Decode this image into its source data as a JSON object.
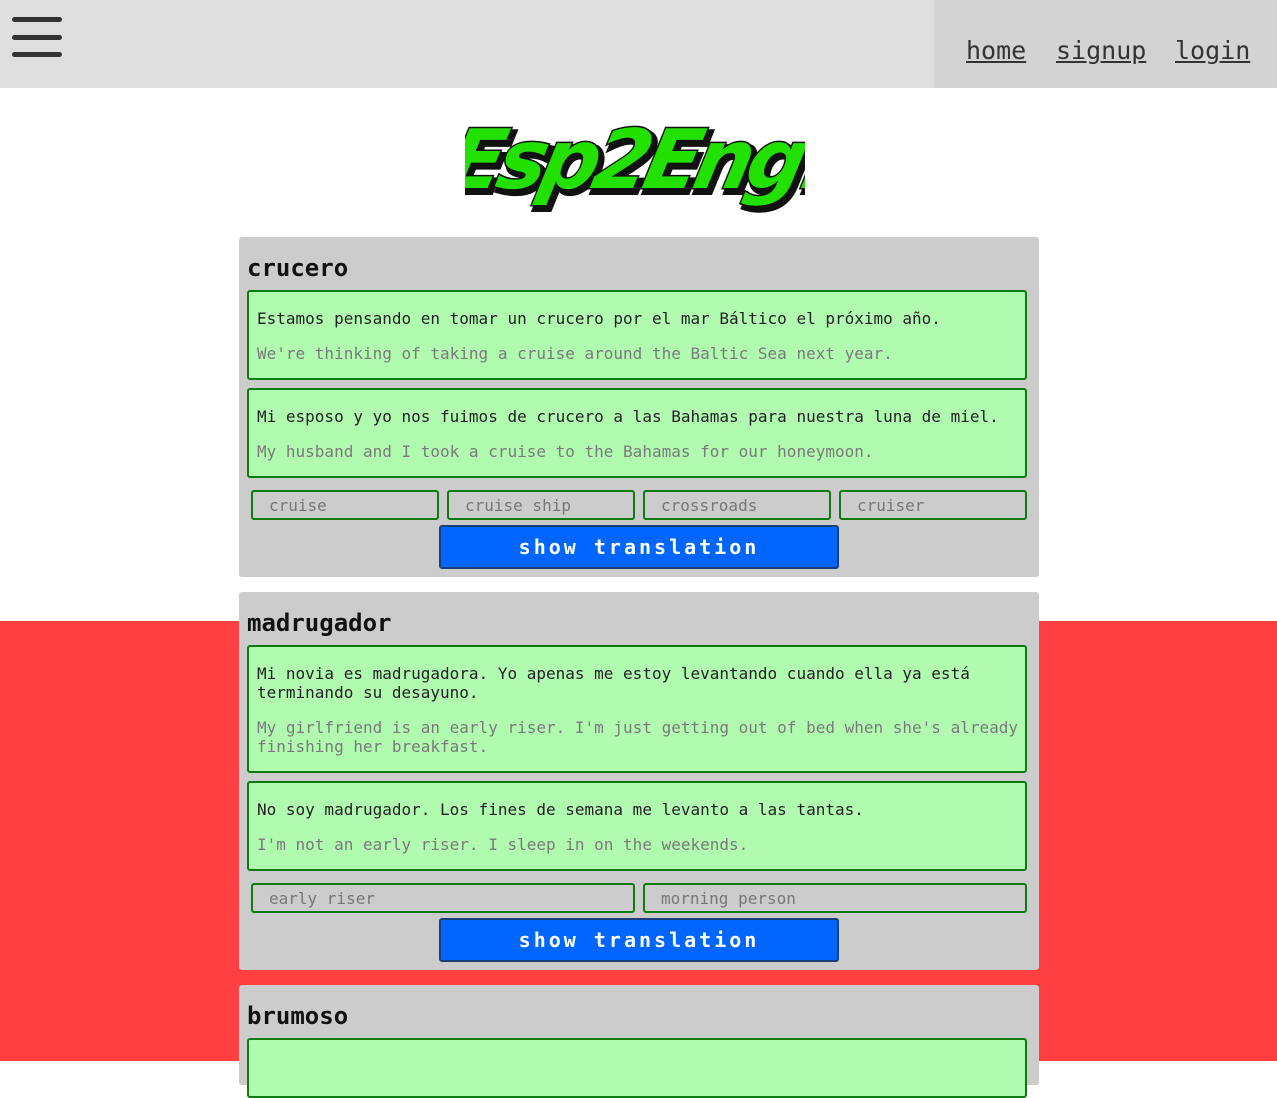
{
  "nav": {
    "home": "home",
    "signup": "signup",
    "login": "login"
  },
  "logo": {
    "text": "Esp2Eng!",
    "fill": "#22e000",
    "outline": "#111111"
  },
  "colors": {
    "page_red": "#ff4040",
    "topbar": "#dedede",
    "card": "#cccccc",
    "sentence_bg": "#b1fbb0",
    "sentence_border": "#0f7a12",
    "button": "#0066ff"
  },
  "cards": [
    {
      "word": "crucero",
      "sentences": [
        {
          "es": "Estamos pensando en tomar un crucero por el mar Báltico el próximo año.",
          "en": "We're thinking of taking a cruise around the Baltic Sea next year."
        },
        {
          "es": "Mi esposo y yo nos fuimos de crucero a las Bahamas para nuestra luna de miel.",
          "en": "My husband and I took a cruise to the Bahamas for our honeymoon."
        }
      ],
      "options": [
        "cruise",
        "cruise ship",
        "crossroads",
        "cruiser"
      ],
      "button": "show translation"
    },
    {
      "word": "madrugador",
      "sentences": [
        {
          "es": "Mi novia es madrugadora. Yo apenas me estoy levantando cuando ella ya está terminando su desayuno.",
          "en": "My girlfriend is an early riser. I'm just getting out of bed when she's already finishing her breakfast."
        },
        {
          "es": "No soy madrugador. Los fines de semana me levanto a las tantas.",
          "en": "I'm not an early riser. I sleep in on the weekends."
        }
      ],
      "options": [
        "early riser",
        "morning person"
      ],
      "button": "show translation"
    },
    {
      "word": "brumoso"
    }
  ]
}
